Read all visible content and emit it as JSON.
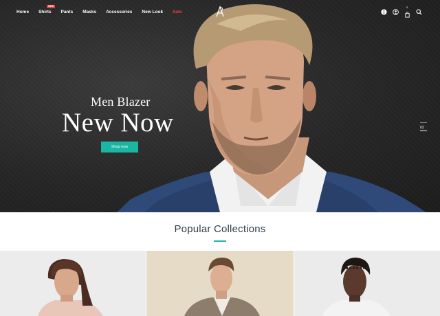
{
  "nav": {
    "items": [
      {
        "label": "Home"
      },
      {
        "label": "Shirts",
        "badge": "NEW"
      },
      {
        "label": "Pants"
      },
      {
        "label": "Masks"
      },
      {
        "label": "Accessories"
      },
      {
        "label": "New Look"
      },
      {
        "label": "Sale"
      }
    ],
    "cart_count": "0"
  },
  "hero": {
    "subtitle": "Men Blazer",
    "title": "New Now",
    "button_label": "Shop now",
    "slide_number": "03"
  },
  "collections": {
    "title": "Popular Collections"
  },
  "colors": {
    "accent": "#1bb6a1",
    "sale": "#e0423f",
    "hero_bg": "#262626"
  },
  "icons": [
    "info-icon",
    "user-icon",
    "cart-icon",
    "search-icon"
  ]
}
